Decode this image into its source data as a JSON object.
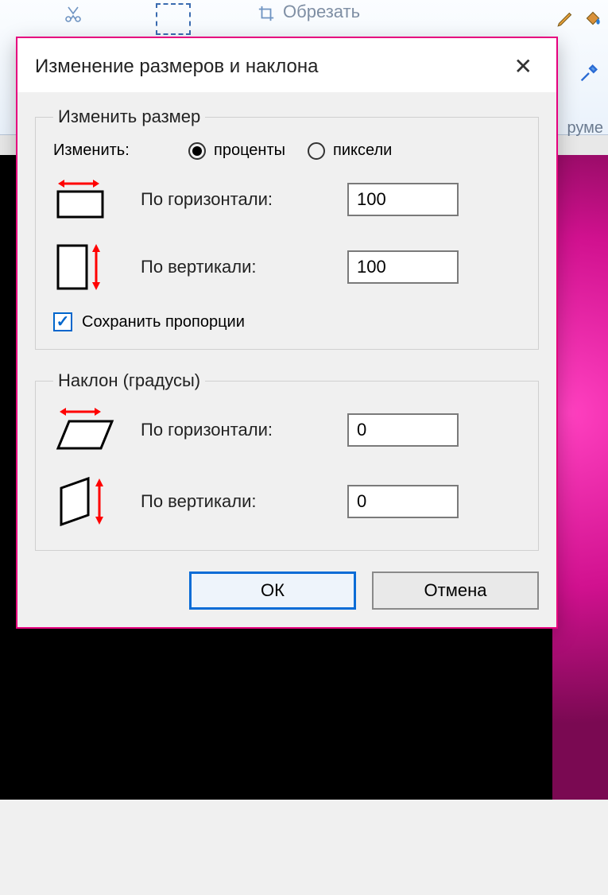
{
  "background": {
    "crop_label": "Обрезать",
    "toolgroup_fragment": "руме"
  },
  "dialog": {
    "title": "Изменение размеров и наклона",
    "resize": {
      "legend": "Изменить размер",
      "by_label": "Изменить:",
      "radio_percent": "проценты",
      "radio_pixels": "пиксели",
      "selected": "percent",
      "horizontal_label": "По горизонтали:",
      "horizontal_value": "100",
      "vertical_label": "По вертикали:",
      "vertical_value": "100",
      "keep_ratio_label": "Сохранить пропорции",
      "keep_ratio_checked": true
    },
    "skew": {
      "legend": "Наклон (градусы)",
      "horizontal_label": "По горизонтали:",
      "horizontal_value": "0",
      "vertical_label": "По вертикали:",
      "vertical_value": "0"
    },
    "buttons": {
      "ok": "ОК",
      "cancel": "Отмена"
    }
  }
}
